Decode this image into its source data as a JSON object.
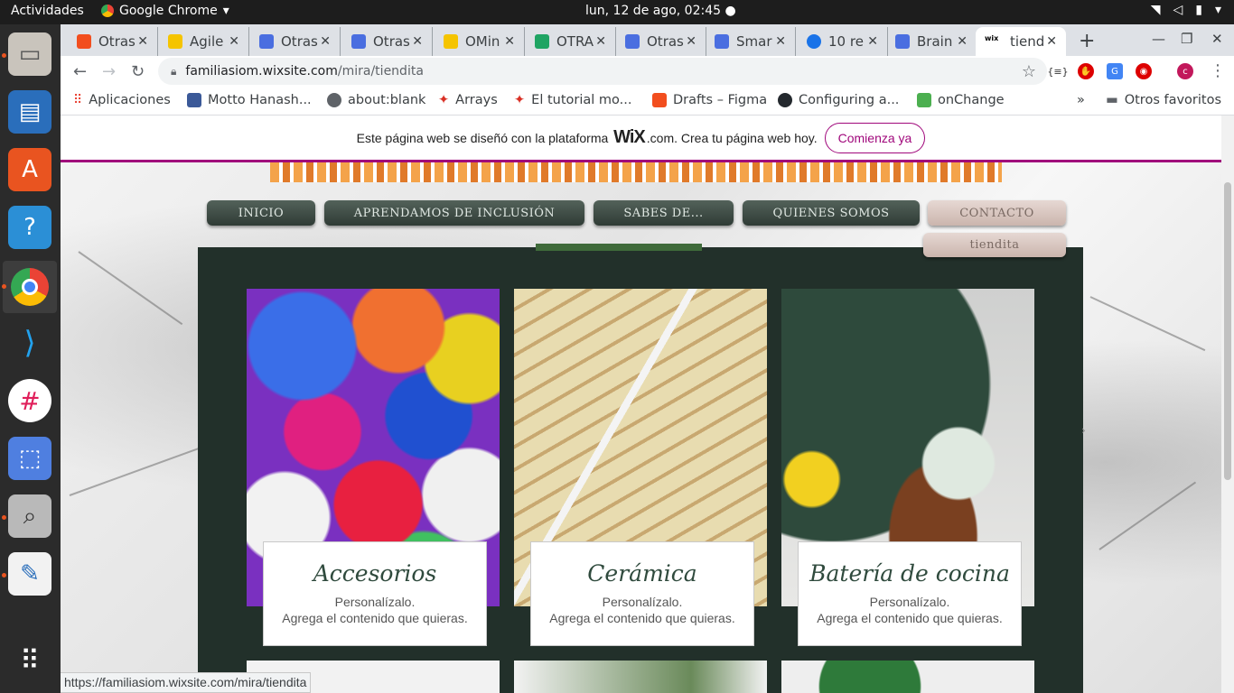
{
  "topbar": {
    "activities": "Actividades",
    "app_name": "Google Chrome",
    "clock": "lun, 12 de ago, 02:45"
  },
  "tabs": [
    {
      "label": "Otras",
      "color": "#f24e1e"
    },
    {
      "label": "Agile",
      "color": "#f5c400"
    },
    {
      "label": "Otras",
      "color": "#4a6ee0"
    },
    {
      "label": "Otras",
      "color": "#4a6ee0"
    },
    {
      "label": "OMin",
      "color": "#f5c400"
    },
    {
      "label": "OTRA",
      "color": "#1fa463"
    },
    {
      "label": "Otras",
      "color": "#4a6ee0"
    },
    {
      "label": "Smar",
      "color": "#4a6ee0"
    },
    {
      "label": "10 re",
      "color": "#1a73e8"
    },
    {
      "label": "Brain",
      "color": "#4a6ee0"
    },
    {
      "label": "tiend",
      "color": "#000000"
    }
  ],
  "address": {
    "host": "familiasiom.wixsite.com",
    "path": "/mira/tiendita"
  },
  "bookmarks": [
    {
      "label": "Aplicaciones",
      "color": "#ea4335"
    },
    {
      "label": "Motto Hanash...",
      "color": "#3b5998"
    },
    {
      "label": "about:blank",
      "color": "#5f6368"
    },
    {
      "label": "Arrays",
      "color": "#d93025"
    },
    {
      "label": "El tutorial mo...",
      "color": "#d93025"
    },
    {
      "label": "Drafts – Figma",
      "color": "#f24e1e"
    },
    {
      "label": "Configuring a...",
      "color": "#24292e"
    },
    {
      "label": "onChange",
      "color": "#4caf50"
    }
  ],
  "bookmarks_more": "»",
  "other_bookmarks": "Otros favoritos",
  "wixbar": {
    "text_before": "Este página web se diseñó con la plataforma",
    "brand": "WiX",
    "text_after": ".com. Crea tu página web hoy.",
    "cta": "Comienza ya"
  },
  "menu": {
    "inicio": "INICIO",
    "aprendamos": "APRENDAMOS DE INCLUSIÓN",
    "sabes": "SABES DE...",
    "quienes": "QUIENES SOMOS",
    "contacto": "CONTACTO",
    "tiendita": "tiendita"
  },
  "products": [
    {
      "title": "Accesorios",
      "line1": "Personalízalo.",
      "line2": "Agrega el contenido que quieras."
    },
    {
      "title": "Cerámica",
      "line1": "Personalízalo.",
      "line2": "Agrega el contenido que quieras."
    },
    {
      "title": "Batería de cocina",
      "line1": "Personalízalo.",
      "line2": "Agrega el contenido que quieras."
    }
  ],
  "status_url": "https://familiasiom.wixsite.com/mira/tiendita"
}
